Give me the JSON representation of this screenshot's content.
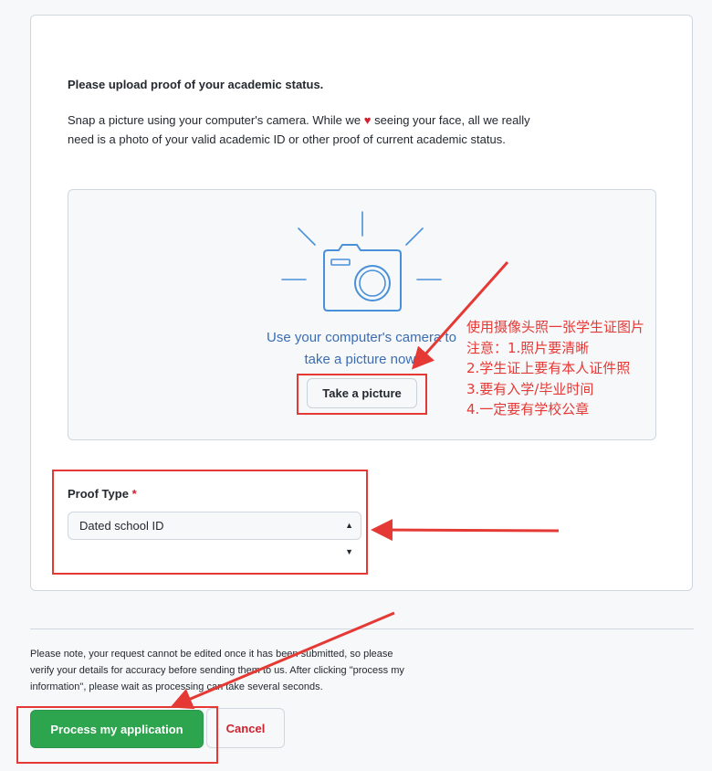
{
  "form": {
    "heading": "Please upload proof of your academic status.",
    "intro_part1": "Snap a picture using your computer's camera. While we",
    "intro_heart": "♥",
    "intro_part2": "seeing your face, all we really need is a photo of your valid academic ID or other proof of current academic status."
  },
  "camera": {
    "icon": "camera-icon",
    "instruction": "Use your computer's camera to take a picture now.",
    "take_button_label": "Take a picture"
  },
  "proof_type": {
    "label": "Proof Type",
    "required_mark": "*",
    "selected_value": "Dated school ID"
  },
  "footer": {
    "note": "Please note, your request cannot be edited once it has been submitted, so please verify your details for accuracy before sending them to us. After clicking \"process my information\", please wait as processing can take several seconds.",
    "process_button_label": "Process my application",
    "cancel_button_label": "Cancel"
  },
  "annotation": {
    "lines": [
      "使用摄像头照一张学生证图片",
      "注意：1.照片要清晰",
      "2.学生证上要有本人证件照",
      "3.要有入学/毕业时间",
      "4.一定要有学校公章"
    ],
    "color": "#e53935"
  },
  "colors": {
    "primary_green": "#2da44e",
    "danger_red": "#cf222e",
    "link_blue": "#3b6db4"
  }
}
